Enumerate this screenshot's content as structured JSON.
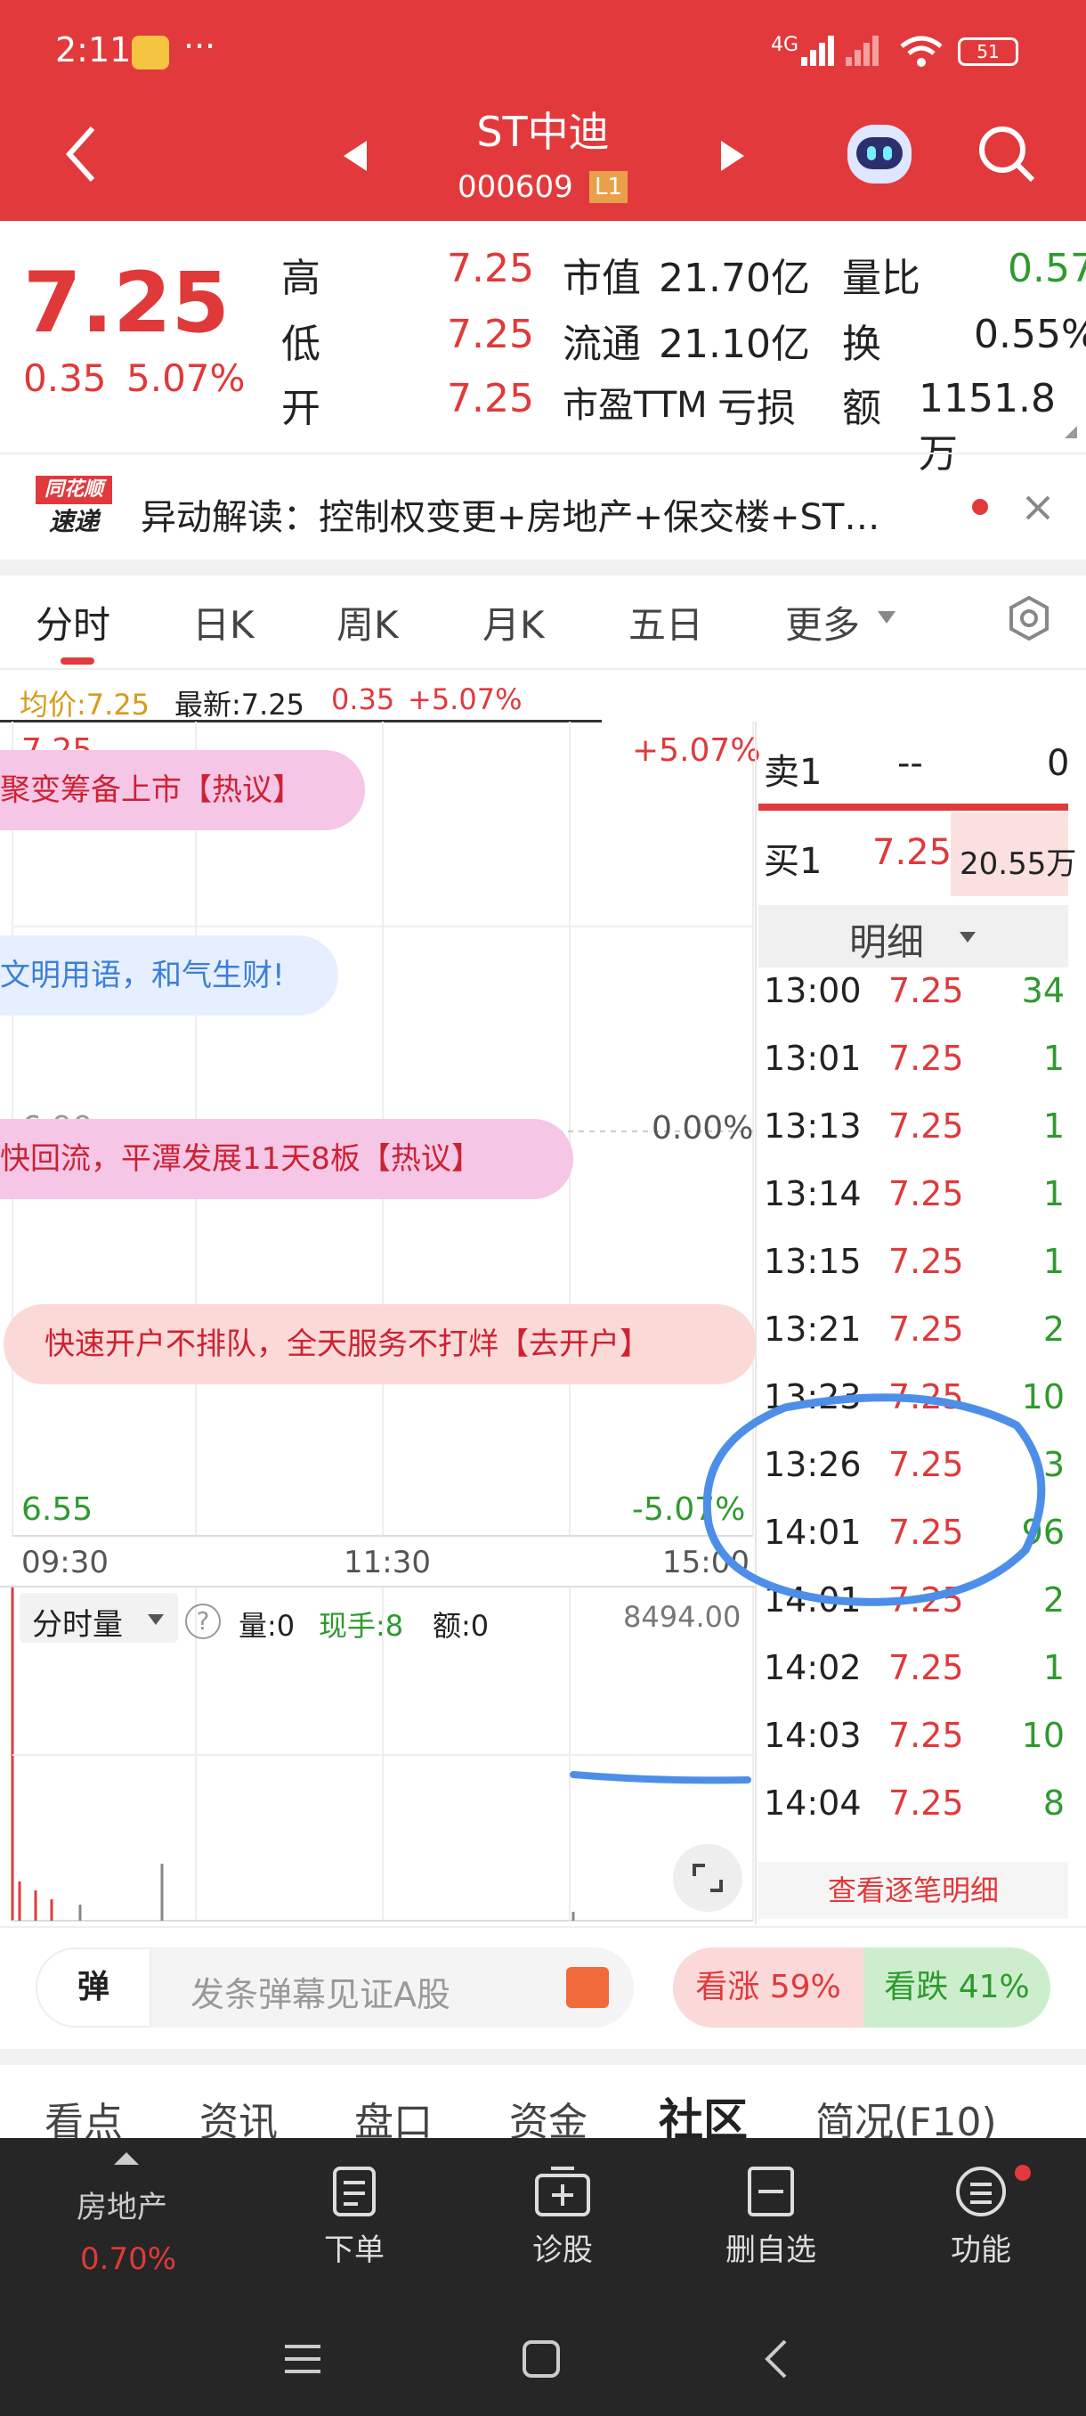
{
  "status": {
    "time": "2:11",
    "dots": "···",
    "network": "4G",
    "battery": "51"
  },
  "header": {
    "name": "ST中迪",
    "code": "000609",
    "level": "L1"
  },
  "quote": {
    "price": "7.25",
    "change": "0.35",
    "pct": "5.07%",
    "high_label": "高",
    "high": "7.25",
    "low_label": "低",
    "low": "7.25",
    "open_label": "开",
    "open": "7.25",
    "mcap_label": "市值",
    "mcap": "21.70亿",
    "float_label": "流通",
    "float": "21.10亿",
    "pe_label": "市盈TTM",
    "pe": "亏损",
    "vr_label": "量比",
    "vr": "0.57",
    "turn_label": "换",
    "turn": "0.55%",
    "amt_label": "额",
    "amt": "1151.8万"
  },
  "news": {
    "logo1": "同花顺",
    "logo2": "速递",
    "text": "异动解读：控制权变更+房地产+保交楼+ST…"
  },
  "tabs": [
    "分时",
    "日K",
    "周K",
    "月K",
    "五日",
    "更多"
  ],
  "legend": {
    "avg": "均价:7.25",
    "latest": "最新:7.25",
    "chg": "0.35",
    "pct": "+5.07%"
  },
  "chart": {
    "top": "7.25",
    "top_pct": "+5.07%",
    "mid": "6.90",
    "mid_pct": "0.00%",
    "bot": "6.55",
    "bot_pct": "-5.07%",
    "t1": "09:30",
    "t2": "11:30",
    "t3": "15:00"
  },
  "danmu": [
    "聚变筹备上市【热议】",
    "文明用语，和气生财!",
    "快回流，平潭发展11天8板【热议】",
    "快速开户不排队，全天服务不打烊【去开户】"
  ],
  "vol": {
    "label": "分时量",
    "info": "?",
    "v": "量:0",
    "hand": "现手:8",
    "amt": "额:0",
    "max": "8494.00"
  },
  "orderbook": {
    "sell": "卖1",
    "sell_p": "--",
    "sell_v": "0",
    "buy": "买1",
    "buy_p": "7.25",
    "buy_v": "20.55万",
    "detail": "明细"
  },
  "trades": [
    [
      "13:00",
      "7.25",
      "34"
    ],
    [
      "13:01",
      "7.25",
      "1"
    ],
    [
      "13:13",
      "7.25",
      "1"
    ],
    [
      "13:14",
      "7.25",
      "1"
    ],
    [
      "13:15",
      "7.25",
      "1"
    ],
    [
      "13:21",
      "7.25",
      "2"
    ],
    [
      "13:23",
      "7.25",
      "10"
    ],
    [
      "13:26",
      "7.25",
      "3"
    ],
    [
      "14:01",
      "7.25",
      "96"
    ],
    [
      "14:01",
      "7.25",
      "2"
    ],
    [
      "14:02",
      "7.25",
      "1"
    ],
    [
      "14:03",
      "7.25",
      "10"
    ],
    [
      "14:04",
      "7.25",
      "8"
    ]
  ],
  "view_all": "查看逐笔明细",
  "comment": {
    "icon": "弹",
    "placeholder": "发条弹幕见证A股",
    "up": "看涨 59%",
    "down": "看跌 41%"
  },
  "subtabs": [
    "看点",
    "资讯",
    "盘口",
    "资金",
    "社区",
    "简况(F10)"
  ],
  "bottom": {
    "sector": "房地产",
    "sector_pct": "0.70%",
    "order": "下单",
    "diag": "诊股",
    "del": "删自选",
    "func": "功能"
  }
}
